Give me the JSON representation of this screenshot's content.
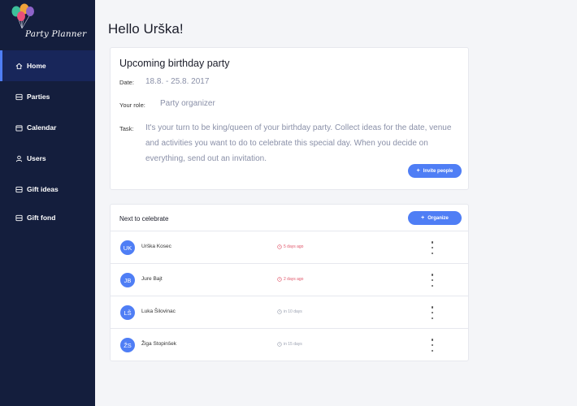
{
  "app": {
    "name": "Party Planner"
  },
  "sidebar": {
    "items": [
      {
        "label": "Home",
        "icon": "home-icon",
        "active": true
      },
      {
        "label": "Parties",
        "icon": "list-icon",
        "active": false
      },
      {
        "label": "Calendar",
        "icon": "calendar-icon",
        "active": false
      },
      {
        "label": "Users",
        "icon": "user-icon",
        "active": false
      },
      {
        "label": "Gift ideas",
        "icon": "list-icon",
        "active": false
      },
      {
        "label": "Gift fond",
        "icon": "list-icon",
        "active": false
      }
    ]
  },
  "greeting": "Hello Urška!",
  "upcoming": {
    "title": "Upcoming birthday party",
    "date_label": "Date:",
    "date_value": "18.8. - 25.8. 2017",
    "role_label": "Your role:",
    "role_value": "Party organizer",
    "task_label": "Task:",
    "task_value": "It's your turn to be king/queen of your birthday party. Collect ideas for the date, venue and activities you want to do to celebrate this special day. When you decide on everything, send out an invitation.",
    "invite_button": "Invite people"
  },
  "next": {
    "title": "Next to celebrate",
    "organize_button": "Organize",
    "people": [
      {
        "initials": "UK",
        "name": "Urška Kosec",
        "when": "5 days ago",
        "status": "past"
      },
      {
        "initials": "JB",
        "name": "Jure Bajt",
        "when": "2 days ago",
        "status": "past"
      },
      {
        "initials": "LŠ",
        "name": "Luka Šilovinac",
        "when": "in 10 days",
        "status": "future"
      },
      {
        "initials": "ŽS",
        "name": "Žiga Stopinšek",
        "when": "in 15 days",
        "status": "future"
      }
    ]
  },
  "colors": {
    "sidebar_bg": "#141e3d",
    "accent": "#4f7ef5",
    "past": "#e0566a",
    "future": "#9aa0b0"
  }
}
